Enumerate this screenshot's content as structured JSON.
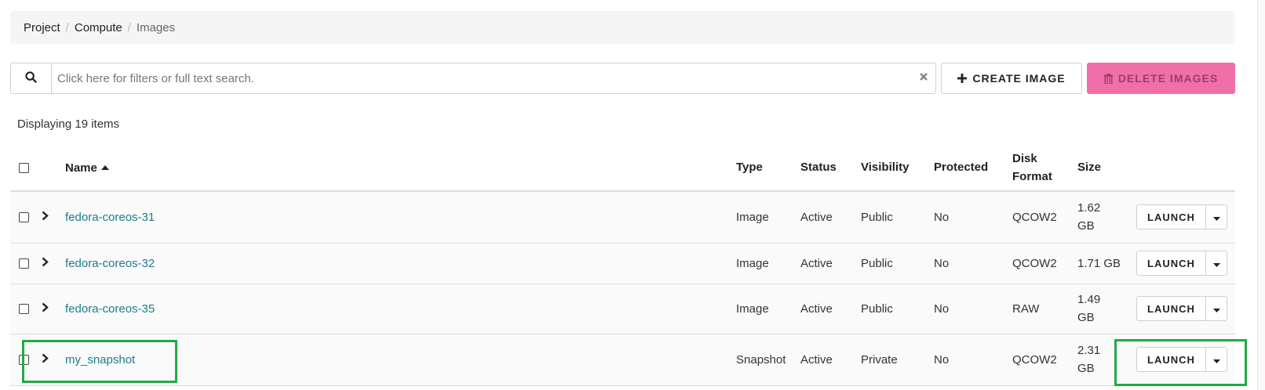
{
  "breadcrumb": [
    {
      "label": "Project"
    },
    {
      "label": "Compute"
    },
    {
      "label": "Images"
    }
  ],
  "breadcrumb_separator": "/",
  "search": {
    "placeholder": "Click here for filters or full text search.",
    "value": "",
    "icon": "search-icon",
    "clear_icon": "close-icon"
  },
  "toolbar": {
    "create_label": "CREATE IMAGE",
    "create_icon": "plus-icon",
    "delete_label": "DELETE IMAGES",
    "delete_icon": "trash-icon"
  },
  "count_text": "Displaying 19 items",
  "table": {
    "columns": {
      "name": "Name",
      "type": "Type",
      "status": "Status",
      "visibility": "Visibility",
      "protected": "Protected",
      "disk_format_line1": "Disk",
      "disk_format_line2": "Format",
      "size": "Size"
    },
    "rows": [
      {
        "name": "fedora-coreos-31",
        "type": "Image",
        "status": "Active",
        "visibility": "Public",
        "protected": "No",
        "disk_format": "QCOW2",
        "size_line1": "1.62",
        "size_line2": "GB",
        "action": "LAUNCH"
      },
      {
        "name": "fedora-coreos-32",
        "type": "Image",
        "status": "Active",
        "visibility": "Public",
        "protected": "No",
        "disk_format": "QCOW2",
        "size_line1": "1.71 GB",
        "size_line2": "",
        "action": "LAUNCH"
      },
      {
        "name": "fedora-coreos-35",
        "type": "Image",
        "status": "Active",
        "visibility": "Public",
        "protected": "No",
        "disk_format": "RAW",
        "size_line1": "1.49",
        "size_line2": "GB",
        "action": "LAUNCH"
      },
      {
        "name": "my_snapshot",
        "type": "Snapshot",
        "status": "Active",
        "visibility": "Private",
        "protected": "No",
        "disk_format": "QCOW2",
        "size_line1": "2.31",
        "size_line2": "GB",
        "action": "LAUNCH"
      }
    ]
  },
  "colors": {
    "link": "#1e7b8c",
    "delete_bg": "#f06fa8",
    "highlight": "#22aa44"
  }
}
